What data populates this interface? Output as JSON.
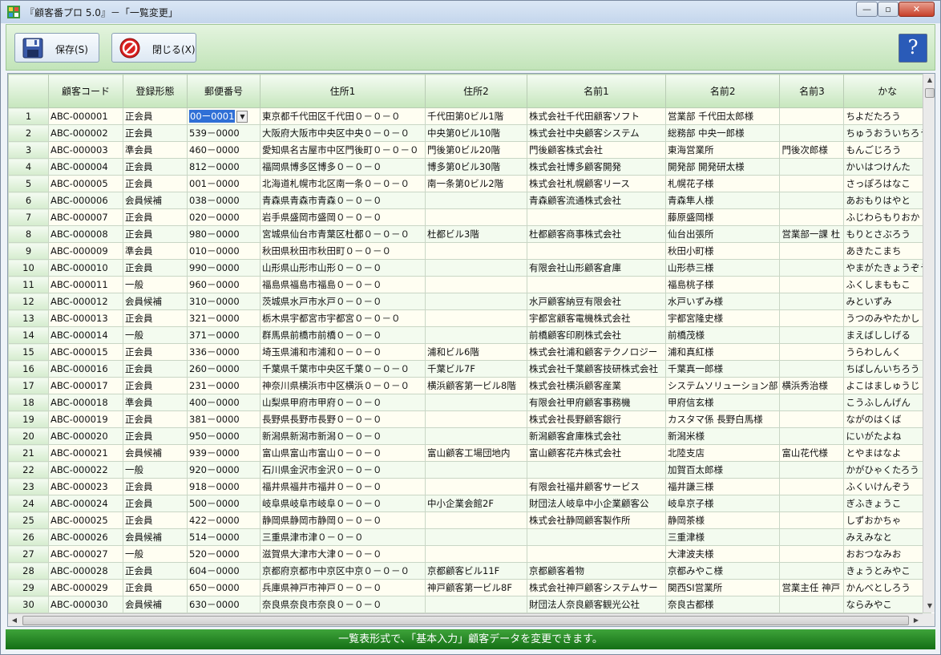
{
  "window": {
    "title": "『顧客番プロ 5.0』－「一覧変更」",
    "min_glyph": "—",
    "max_glyph": "▫",
    "close_glyph": "✕"
  },
  "toolbar": {
    "save_label": "保存(S)",
    "close_label": "閉じる(X)",
    "help_glyph": "?"
  },
  "columns": [
    "顧客コード",
    "登録形態",
    "郵便番号",
    "住所1",
    "住所2",
    "名前1",
    "名前2",
    "名前3",
    "かな"
  ],
  "rows": [
    [
      "1",
      "ABC-000001",
      "正会員",
      "00ー0001",
      "東京都千代田区千代田０－０－０",
      "千代田第0ビル1階",
      "株式会社千代田顧客ソフト",
      "営業部 千代田太郎様",
      "",
      "ちよだたろう"
    ],
    [
      "2",
      "ABC-000002",
      "正会員",
      "539－0000",
      "大阪府大阪市中央区中央０－０－０",
      "中央第0ビル10階",
      "株式会社中央顧客システム",
      "総務部 中央一郎様",
      "",
      "ちゅうおういちろう"
    ],
    [
      "3",
      "ABC-000003",
      "準会員",
      "460－0000",
      "愛知県名古屋市中区門後町０－０－０",
      "門後第0ビル20階",
      "門後顧客株式会社",
      "東海営業所",
      "門後次郎様",
      "もんごじろう"
    ],
    [
      "4",
      "ABC-000004",
      "正会員",
      "812－0000",
      "福岡県博多区博多０－０－０",
      "博多第0ビル30階",
      "株式会社博多顧客開発",
      "開発部 開発研太様",
      "",
      "かいはつけんた"
    ],
    [
      "5",
      "ABC-000005",
      "正会員",
      "001－0000",
      "北海道札幌市北区南一条０－０－０",
      "南一条第0ビル2階",
      "株式会社札幌顧客リース",
      "札幌花子様",
      "",
      "さっぽろはなこ"
    ],
    [
      "6",
      "ABC-000006",
      "会員候補",
      "038－0000",
      "青森県青森市青森０－０－０",
      "",
      "青森顧客流通株式会社",
      "青森隼人様",
      "",
      "あおもりはやと"
    ],
    [
      "7",
      "ABC-000007",
      "正会員",
      "020－0000",
      "岩手県盛岡市盛岡０－０－０",
      "",
      "",
      "藤原盛岡様",
      "",
      "ふじわらもりおか"
    ],
    [
      "8",
      "ABC-000008",
      "正会員",
      "980－0000",
      "宮城県仙台市青葉区杜都０－０－０",
      "杜都ビル3階",
      "杜都顧客商事株式会社",
      "仙台出張所",
      "営業部一課 杜",
      "もりとさぶろう"
    ],
    [
      "9",
      "ABC-000009",
      "準会員",
      "010－0000",
      "秋田県秋田市秋田町０－０－０",
      "",
      "",
      "秋田小町様",
      "",
      "あきたこまち"
    ],
    [
      "10",
      "ABC-000010",
      "正会員",
      "990－0000",
      "山形県山形市山形０－０－０",
      "",
      "有限会社山形顧客倉庫",
      "山形恭三様",
      "",
      "やまがたきょうぞう"
    ],
    [
      "11",
      "ABC-000011",
      "一般",
      "960－0000",
      "福島県福島市福島０－０－０",
      "",
      "",
      "福島桃子様",
      "",
      "ふくしまももこ"
    ],
    [
      "12",
      "ABC-000012",
      "会員候補",
      "310－0000",
      "茨城県水戸市水戸０－０－０",
      "",
      "水戸顧客納豆有限会社",
      "水戸いずみ様",
      "",
      "みといずみ"
    ],
    [
      "13",
      "ABC-000013",
      "正会員",
      "321－0000",
      "栃木県宇都宮市宇都宮０－０－０",
      "",
      "宇都宮顧客電機株式会社",
      "宇都宮隆史様",
      "",
      "うつのみやたかし"
    ],
    [
      "14",
      "ABC-000014",
      "一般",
      "371－0000",
      "群馬県前橋市前橋０－０－０",
      "",
      "前橋顧客印刷株式会社",
      "前橋茂様",
      "",
      "まえばししげる"
    ],
    [
      "15",
      "ABC-000015",
      "正会員",
      "336－0000",
      "埼玉県浦和市浦和０－０－０",
      "浦和ビル6階",
      "株式会社浦和顧客テクノロジー",
      "浦和真紅様",
      "",
      "うらわしんく"
    ],
    [
      "16",
      "ABC-000016",
      "正会員",
      "260－0000",
      "千葉県千葉市中央区千葉０－０－０",
      "千葉ビル7F",
      "株式会社千葉顧客技研株式会社",
      "千葉真一郎様",
      "",
      "ちばしんいちろう"
    ],
    [
      "17",
      "ABC-000017",
      "正会員",
      "231－0000",
      "神奈川県横浜市中区横浜０－０－０",
      "横浜顧客第一ビル8階",
      "株式会社横浜顧客産業",
      "システムソリューション部",
      "横浜秀治様",
      "よこはましゅうじ"
    ],
    [
      "18",
      "ABC-000018",
      "準会員",
      "400－0000",
      "山梨県甲府市甲府０－０－０",
      "",
      "有限会社甲府顧客事務機",
      "甲府信玄様",
      "",
      "こうふしんげん"
    ],
    [
      "19",
      "ABC-000019",
      "正会員",
      "381－0000",
      "長野県長野市長野０－０－０",
      "",
      "株式会社長野顧客銀行",
      "カスタマ係 長野白馬様",
      "",
      "ながのはくば"
    ],
    [
      "20",
      "ABC-000020",
      "正会員",
      "950－0000",
      "新潟県新潟市新潟０－０－０",
      "",
      "新潟顧客倉庫株式会社",
      "新潟米様",
      "",
      "にいがたよね"
    ],
    [
      "21",
      "ABC-000021",
      "会員候補",
      "939－0000",
      "富山県富山市富山０－０－０",
      "富山顧客工場団地内",
      "富山顧客花卉株式会社",
      "北陸支店",
      "富山花代様",
      "とやまはなよ"
    ],
    [
      "22",
      "ABC-000022",
      "一般",
      "920－0000",
      "石川県金沢市金沢０－０－０",
      "",
      "",
      "加賀百太郎様",
      "",
      "かがひゃくたろう"
    ],
    [
      "23",
      "ABC-000023",
      "正会員",
      "918－0000",
      "福井県福井市福井０－０－０",
      "",
      "有限会社福井顧客サービス",
      "福井謙三様",
      "",
      "ふくいけんぞう"
    ],
    [
      "24",
      "ABC-000024",
      "正会員",
      "500－0000",
      "岐阜県岐阜市岐阜０－０－０",
      "中小企業会館2F",
      "財団法人岐阜中小企業顧客公",
      "岐阜京子様",
      "",
      "ぎふきょうこ"
    ],
    [
      "25",
      "ABC-000025",
      "正会員",
      "422－0000",
      "静岡県静岡市静岡０－０－０",
      "",
      "株式会社静岡顧客製作所",
      "静岡茶様",
      "",
      "しずおかちゃ"
    ],
    [
      "26",
      "ABC-000026",
      "会員候補",
      "514－0000",
      "三重県津市津０－０－０",
      "",
      "",
      "三重津様",
      "",
      "みえみなと"
    ],
    [
      "27",
      "ABC-000027",
      "一般",
      "520－0000",
      "滋賀県大津市大津０－０－０",
      "",
      "",
      "大津波夫様",
      "",
      "おおつなみお"
    ],
    [
      "28",
      "ABC-000028",
      "正会員",
      "604－0000",
      "京都府京都市中京区中京０－０－０",
      "京都顧客ビル11F",
      "京都顧客着物",
      "京都みやこ様",
      "",
      "きょうとみやこ"
    ],
    [
      "29",
      "ABC-000029",
      "正会員",
      "650－0000",
      "兵庫県神戸市神戸０－０－０",
      "神戸顧客第一ビル8F",
      "株式会社神戸顧客システムサー",
      "関西SI営業所",
      "営業主任 神戸",
      "かんべとしろう"
    ],
    [
      "30",
      "ABC-000030",
      "会員候補",
      "630－0000",
      "奈良県奈良市奈良０－０－０",
      "",
      "財団法人奈良顧客観光公社",
      "奈良古都様",
      "",
      "ならみやこ"
    ]
  ],
  "status": {
    "message": "一覧表形式で、「基本入力」顧客データを変更できます。"
  },
  "colors": {
    "toolbar_green": "#c2e4b9",
    "status_green": "#146f15",
    "selection_blue": "#2f6fd6"
  }
}
